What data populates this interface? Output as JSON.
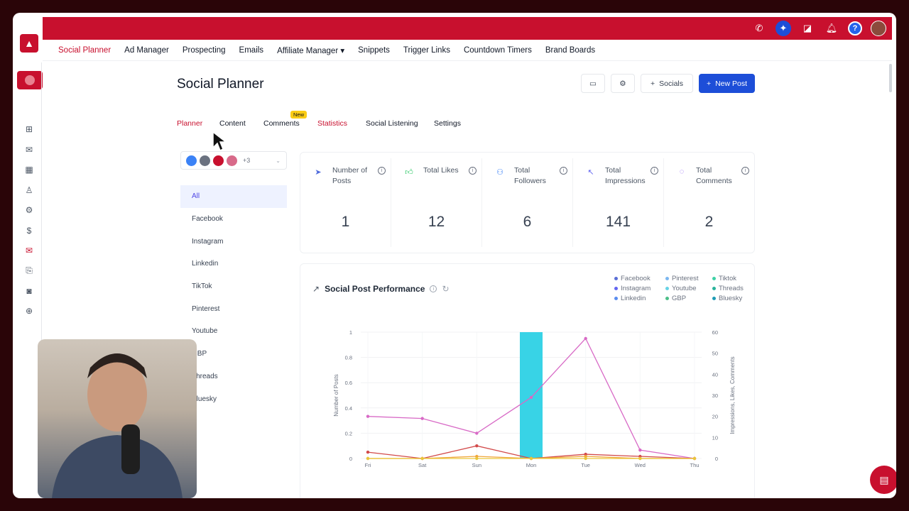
{
  "topnav": {
    "items": [
      "Social Planner",
      "Ad Manager",
      "Prospecting",
      "Emails",
      "Affiliate Manager",
      "Snippets",
      "Trigger Links",
      "Countdown Timers",
      "Brand Boards"
    ],
    "active_index": 0,
    "dropdown_caret": "▾"
  },
  "topbar_icons": [
    "phone-icon",
    "magic-icon",
    "megaphone-icon",
    "bell-icon",
    "help-icon",
    "avatar"
  ],
  "page": {
    "title": "Social Planner"
  },
  "header_buttons": {
    "socials_label": "Socials",
    "new_post_label": "New Post"
  },
  "tabs": {
    "planner": "Planner",
    "content": "Content",
    "comments": "Comments",
    "new_badge": "New",
    "statistics": "Statistics",
    "social_listening": "Social Listening",
    "settings": "Settings"
  },
  "social_select": {
    "more_count": "+3"
  },
  "platforms": [
    "All",
    "Facebook",
    "Instagram",
    "Linkedin",
    "TikTok",
    "Pinterest",
    "Youtube",
    "GBP",
    "Threads",
    "Bluesky"
  ],
  "stats": [
    {
      "label": "Number of Posts",
      "value": "1",
      "icon": "send-icon",
      "color": "#4f6bdc"
    },
    {
      "label": "Total Likes",
      "value": "12",
      "icon": "thumbs-up-icon",
      "color": "#22c55e"
    },
    {
      "label": "Total Followers",
      "value": "6",
      "icon": "users-icon",
      "color": "#3b82f6"
    },
    {
      "label": "Total Impressions",
      "value": "141",
      "icon": "pointer-icon",
      "color": "#6366f1"
    },
    {
      "label": "Total Comments",
      "value": "2",
      "icon": "comment-icon",
      "color": "#8b5cf6"
    }
  ],
  "chart_panel": {
    "title": "Social Post Performance"
  },
  "legend": [
    {
      "name": "Facebook",
      "color": "#5b6fd6"
    },
    {
      "name": "Pinterest",
      "color": "#7cb7f0"
    },
    {
      "name": "Tiktok",
      "color": "#3fd1a6"
    },
    {
      "name": "Instagram",
      "color": "#6366f1"
    },
    {
      "name": "Youtube",
      "color": "#67d3e6"
    },
    {
      "name": "Threads",
      "color": "#2ab39b"
    },
    {
      "name": "Linkedin",
      "color": "#5b8def"
    },
    {
      "name": "GBP",
      "color": "#4cbf88"
    },
    {
      "name": "Bluesky",
      "color": "#1e9bb5"
    }
  ],
  "chart_data": {
    "type": "bar",
    "categories": [
      "Fri",
      "Sat",
      "Sun",
      "Mon",
      "Tue",
      "Wed",
      "Thu"
    ],
    "ylabel_left": "Number of Posts",
    "ylabel_right": "Impressions, Likes, Comments",
    "ylim_left": [
      0,
      1
    ],
    "ylim_right": [
      0,
      60
    ],
    "left_ticks": [
      "0",
      "0.2",
      "0.4",
      "0.6",
      "0.8",
      "1"
    ],
    "right_ticks": [
      "0",
      "10",
      "20",
      "30",
      "40",
      "50",
      "60"
    ],
    "bar_series": {
      "values": [
        0,
        0,
        0,
        1,
        0,
        0,
        0
      ],
      "color": "#38d3e6"
    },
    "line_series": [
      {
        "values": [
          20,
          19,
          12,
          29,
          57,
          4,
          0
        ],
        "color": "#d86ac6"
      },
      {
        "values": [
          3,
          0,
          6,
          0,
          2,
          1,
          0
        ],
        "color": "#d24a4a"
      },
      {
        "values": [
          0,
          0,
          1,
          0,
          1,
          0,
          0
        ],
        "color": "#f0a63a"
      },
      {
        "values": [
          0,
          0,
          0,
          0,
          0,
          0,
          0
        ],
        "color": "#e9c63a"
      }
    ]
  }
}
